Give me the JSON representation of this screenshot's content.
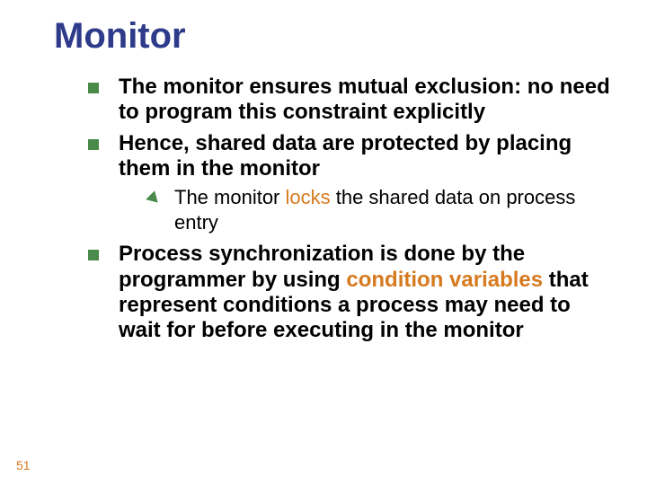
{
  "title": "Monitor",
  "bullets": {
    "b1": "The monitor ensures mutual exclusion: no need to program this constraint explicitly",
    "b2": "Hence, shared data are protected by placing them in the monitor",
    "b2_sub_pre": "The monitor ",
    "b2_sub_hl": "locks",
    "b2_sub_post": " the shared data on process entry",
    "b3_pre": "Process synchronization is done by the programmer by using ",
    "b3_hl": "condition variables",
    "b3_post": " that represent conditions a process may need to wait for before executing in the monitor"
  },
  "page": "51"
}
